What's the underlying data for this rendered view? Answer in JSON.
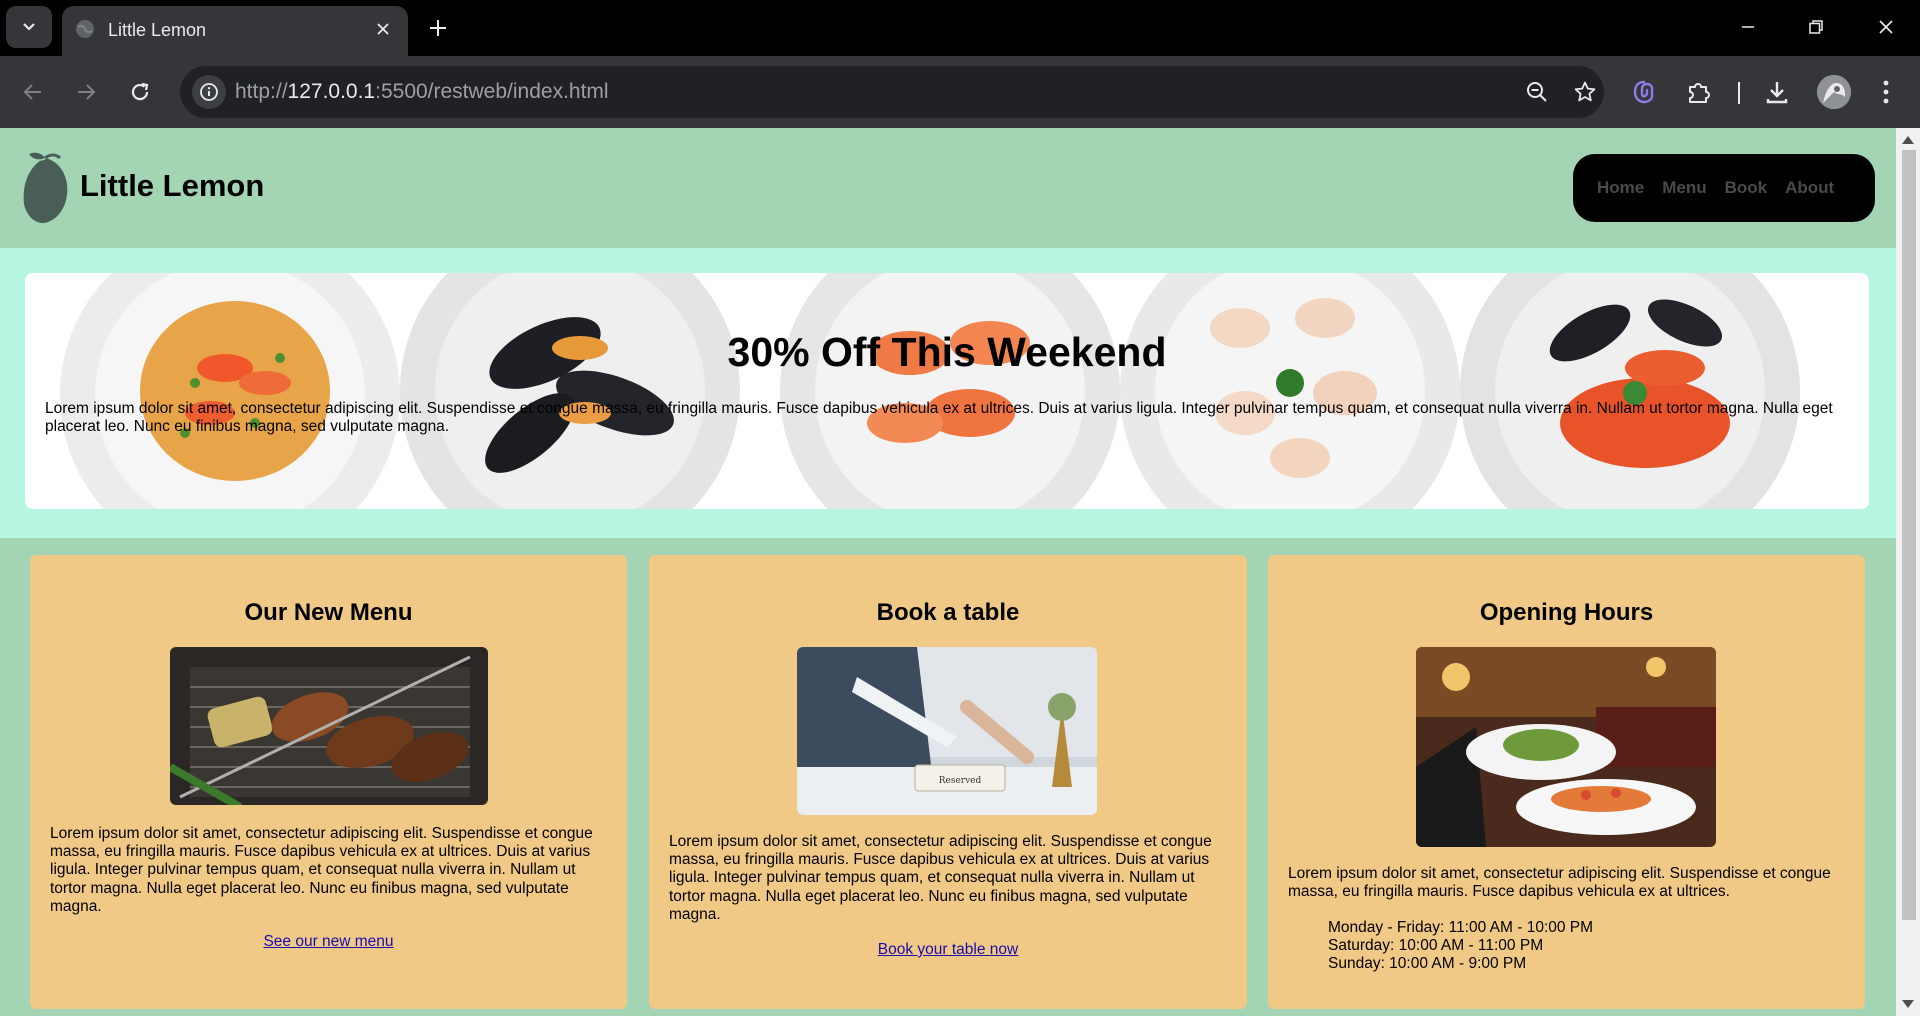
{
  "browser": {
    "tab_title": "Little Lemon",
    "url_scheme": "http://",
    "url_host": "127.0.0.1",
    "url_rest": ":5500/restweb/index.html",
    "icons": [
      "tab-search-icon",
      "globe-icon",
      "close-icon",
      "plus-icon",
      "minimize-icon",
      "restore-icon",
      "window-close-icon",
      "back-icon",
      "forward-icon",
      "reload-icon",
      "site-info-icon",
      "zoom-icon",
      "star-icon",
      "extension-icon",
      "puzzle-icon",
      "download-icon",
      "avatar",
      "menu-dots-icon"
    ]
  },
  "site": {
    "brand": "Little Lemon",
    "nav": [
      "Home",
      "Menu",
      "Book",
      "About"
    ],
    "hero": {
      "title": "30% Off This Weekend",
      "text": "Lorem ipsum dolor sit amet, consectetur adipiscing elit. Suspendisse et congue massa, eu fringilla mauris. Fusce dapibus vehicula ex at ultrices. Duis at varius ligula. Integer pulvinar tempus quam, et consequat nulla viverra in. Nullam ut tortor magna. Nulla eget placerat leo. Nunc eu finibus magna, sed vulputate magna."
    },
    "cards": [
      {
        "title": "Our New Menu",
        "text": "Lorem ipsum dolor sit amet, consectetur adipiscing elit. Suspendisse et congue massa, eu fringilla mauris. Fusce dapibus vehicula ex at ultrices. Duis at varius ligula. Integer pulvinar tempus quam, et consequat nulla viverra in. Nullam ut tortor magna. Nulla eget placerat leo. Nunc eu finibus magna, sed vulputate magna.",
        "link": "See our new menu"
      },
      {
        "title": "Book a table",
        "text": "Lorem ipsum dolor sit amet, consectetur adipiscing elit. Suspendisse et congue massa, eu fringilla mauris. Fusce dapibus vehicula ex at ultrices. Duis at varius ligula. Integer pulvinar tempus quam, et consequat nulla viverra in. Nullam ut tortor magna. Nulla eget placerat leo. Nunc eu finibus magna, sed vulputate magna.",
        "link": "Book your table now",
        "photo_label": "Reserved"
      },
      {
        "title": "Opening Hours",
        "text": "Lorem ipsum dolor sit amet, consectetur adipiscing elit. Suspendisse et congue massa, eu fringilla mauris. Fusce dapibus vehicula ex at ultrices.",
        "hours": [
          "Monday - Friday: 11:00 AM - 10:00 PM",
          "Saturday: 10:00 AM - 11:00 PM",
          "Sunday: 10:00 AM - 9:00 PM"
        ]
      }
    ]
  },
  "colors": {
    "header_bg": "#a3d4b3",
    "hero_band": "#b7f5e3",
    "card_bg": "#f0c987",
    "nav_bg": "#000000",
    "logo": "#495e57",
    "link": "#1a0dab"
  }
}
